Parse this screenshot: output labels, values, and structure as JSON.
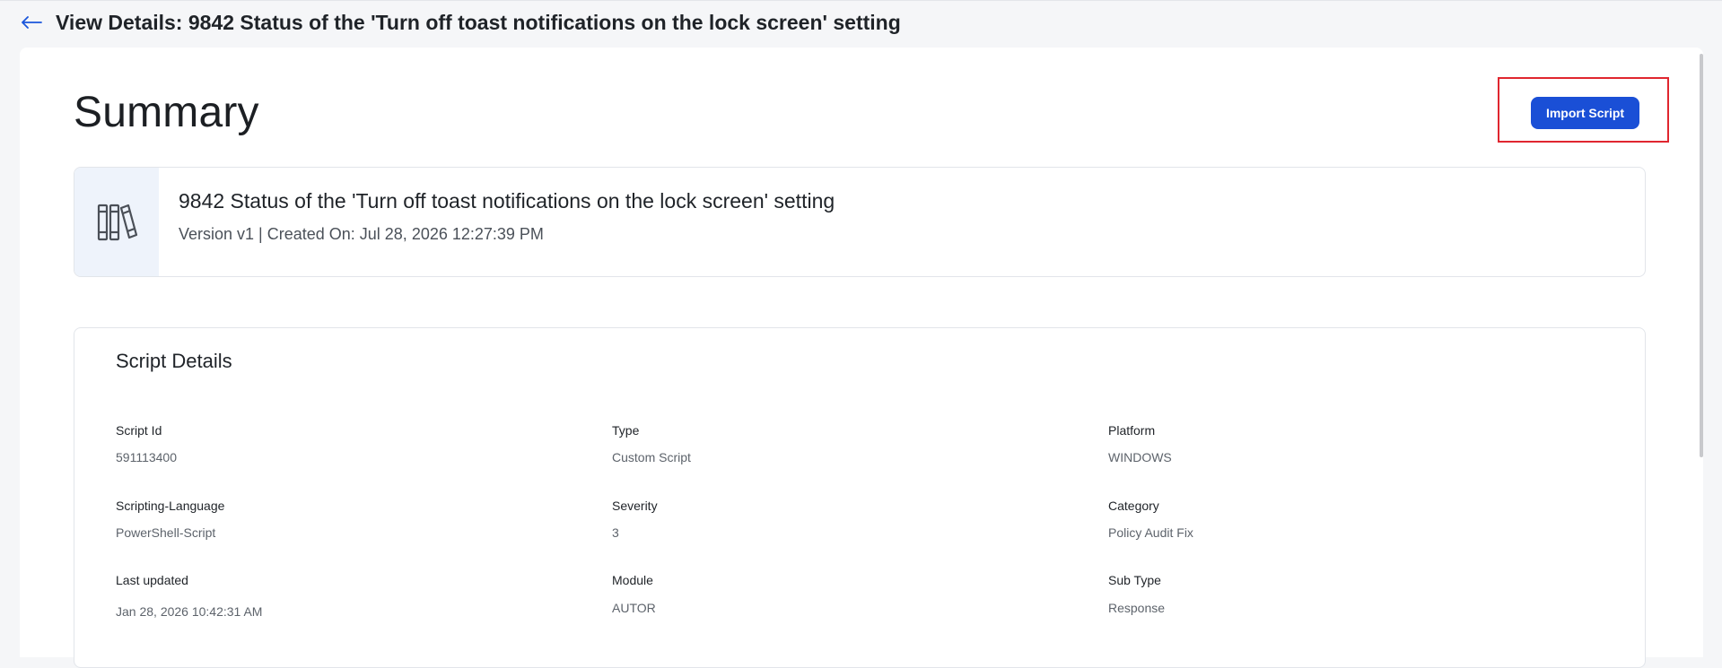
{
  "header": {
    "back_icon": "arrow-left-icon",
    "title": "View Details: 9842 Status of the 'Turn off toast notifications on the lock screen' setting"
  },
  "summary": {
    "title": "Summary",
    "import_button_label": "Import Script",
    "accent_color": "#1a4fd6"
  },
  "info_card": {
    "icon": "library-books-icon",
    "title": "9842 Status of the 'Turn off toast notifications on the lock screen' setting",
    "subtitle": "Version v1 | Created On: Jul 28, 2026 12:27:39 PM"
  },
  "script_details": {
    "heading": "Script Details",
    "fields": [
      {
        "label": "Script Id",
        "value": "591113400"
      },
      {
        "label": "Type",
        "value": "Custom Script"
      },
      {
        "label": "Platform",
        "value": "WINDOWS"
      },
      {
        "label": "Scripting-Language",
        "value": "PowerShell-Script"
      },
      {
        "label": "Severity",
        "value": "3"
      },
      {
        "label": "Category",
        "value": "Policy Audit Fix"
      },
      {
        "label": "Last updated",
        "value": "Jan 28, 2026 10:42:31 AM"
      },
      {
        "label": "Module",
        "value": "AUTOR"
      },
      {
        "label": "Sub Type",
        "value": "Response"
      }
    ]
  }
}
